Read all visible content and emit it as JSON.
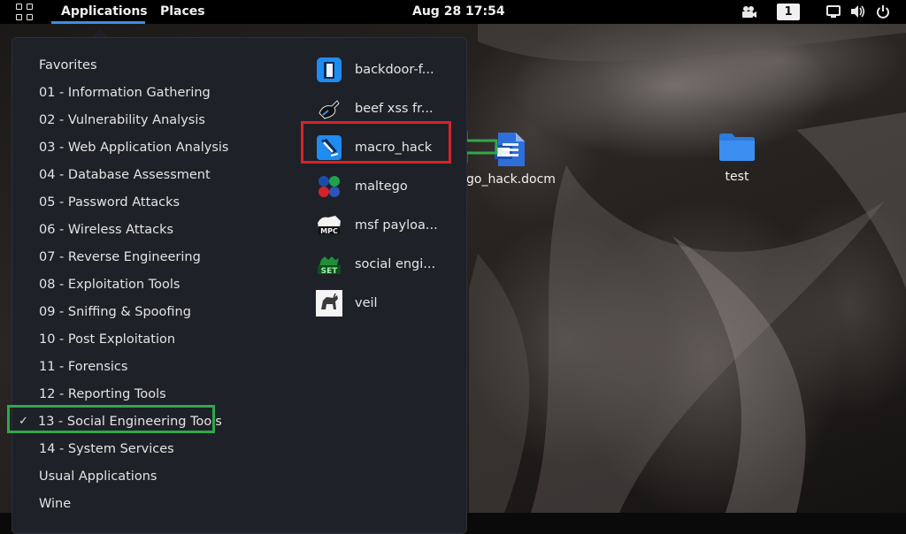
{
  "topbar": {
    "applications": "Applications",
    "places": "Places",
    "clock": "Aug 28  17:54",
    "workspace": "1",
    "icons": [
      "grid-icon",
      "camera-icon",
      "display-icon",
      "volume-icon",
      "power-icon"
    ]
  },
  "menu": {
    "categories": [
      "Favorites",
      "01 - Information Gathering",
      "02 - Vulnerability Analysis",
      "03 - Web Application Analysis",
      "04 - Database Assessment",
      "05 - Password Attacks",
      "06 - Wireless Attacks",
      "07 - Reverse Engineering",
      "08 - Exploitation Tools",
      "09 - Sniffing & Spoofing",
      "10 - Post Exploitation",
      "11 - Forensics",
      "12 - Reporting Tools",
      "13 - Social Engineering Tools",
      "14 - System Services",
      "Usual Applications",
      "Wine"
    ],
    "selected_check": "✓",
    "apps": [
      {
        "label": "backdoor-f...",
        "icon": "backdoor-factory-icon"
      },
      {
        "label": "beef xss fr...",
        "icon": "beef-xss-icon"
      },
      {
        "label": "macro_hack",
        "icon": "macro-hack-icon"
      },
      {
        "label": "maltego",
        "icon": "maltego-icon"
      },
      {
        "label": "msf payloa...",
        "icon": "msfpc-icon"
      },
      {
        "label": "social engi...",
        "icon": "set-icon"
      },
      {
        "label": "veil",
        "icon": "veil-icon"
      }
    ],
    "set_icon_text": "SET",
    "msf_icon_text": "MPC"
  },
  "desktop": {
    "files": [
      {
        "label": "go_hack.docm",
        "icon": "document-icon"
      },
      {
        "label": "test",
        "icon": "folder-icon"
      }
    ]
  },
  "annotation_colors": {
    "red_box": "#d8232a",
    "green": "#2fa84a",
    "accent": "#3c8ce6"
  }
}
